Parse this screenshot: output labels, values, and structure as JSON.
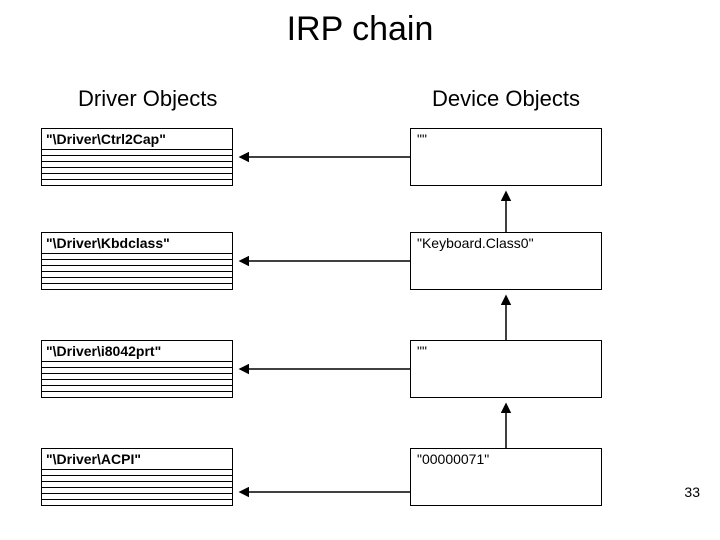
{
  "title": "IRP chain",
  "columns": {
    "left_header": "Driver Objects",
    "right_header": "Device Objects"
  },
  "rows": [
    {
      "driver": "\"\\Driver\\Ctrl2Cap\"",
      "device": "\"\""
    },
    {
      "driver": "\"\\Driver\\Kbdclass\"",
      "device": "\"Keyboard.Class0\""
    },
    {
      "driver": "\"\\Driver\\i8042prt\"",
      "device": "\"\""
    },
    {
      "driver": "\"\\Driver\\ACPI\"",
      "device": "\"00000071\""
    }
  ],
  "page_number": "33"
}
